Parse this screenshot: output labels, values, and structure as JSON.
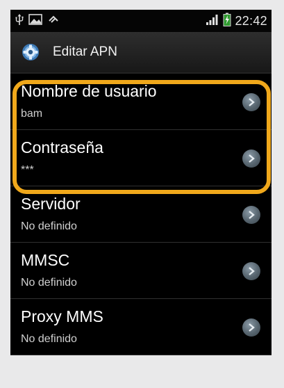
{
  "status_bar": {
    "time": "22:42",
    "left_icons": [
      "usb-icon",
      "image-icon",
      "sync-icon"
    ],
    "right_icons": [
      "signal-icon",
      "battery-charging-icon"
    ]
  },
  "header": {
    "title": "Editar APN",
    "icon": "settings-gear-icon"
  },
  "settings": [
    {
      "label": "Nombre de usuario",
      "value": "bam"
    },
    {
      "label": "Contraseña",
      "value": "***"
    },
    {
      "label": "Servidor",
      "value": "No definido"
    },
    {
      "label": "MMSC",
      "value": "No definido"
    },
    {
      "label": "Proxy MMS",
      "value": "No definido"
    }
  ],
  "colors": {
    "highlight": "#f0a81b",
    "background": "#000000",
    "outer_background": "#e9e9ea"
  }
}
